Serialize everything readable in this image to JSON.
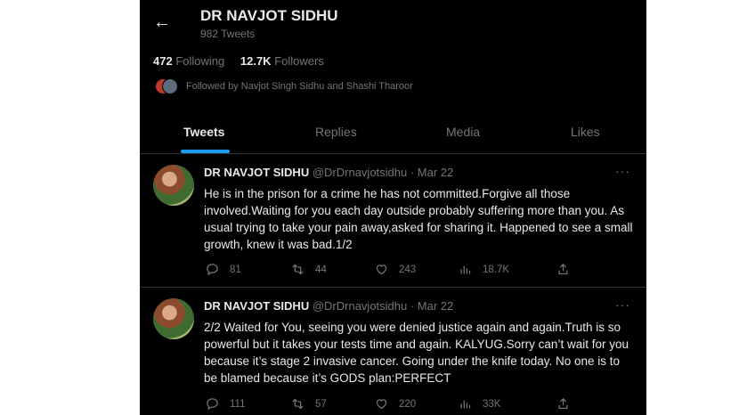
{
  "profile": {
    "name": "DR NAVJOT SIDHU",
    "tweet_count": "982 Tweets",
    "following_count": "472",
    "following_label": "Following",
    "followers_count": "12.7K",
    "followers_label": "Followers",
    "followed_by": "Followed by Navjot Singh Sidhu and Shashi Tharoor"
  },
  "tabs": [
    {
      "label": "Tweets",
      "active": true
    },
    {
      "label": "Replies"
    },
    {
      "label": "Media"
    },
    {
      "label": "Likes"
    }
  ],
  "tweets": [
    {
      "name": "DR NAVJOT SIDHU",
      "meta": "@DrDrnavjotsidhu · Mar 22",
      "text": "He is in the prison for a crime he has not committed.Forgive all those involved.Waiting for you each day outside probably suffering more than you. As usual trying to take your pain away,asked for sharing it. Happened to see a small growth, knew it was bad.1/2",
      "replies": "81",
      "retweets": "44",
      "likes": "243",
      "views": "18.7K"
    },
    {
      "name": "DR NAVJOT SIDHU",
      "meta": "@DrDrnavjotsidhu · Mar 22",
      "text": "2/2 Waited for You, seeing you were denied justice again and again.Truth is so powerful but it takes your tests time and again. KALYUG.Sorry can’t wait for you because it’s stage 2 invasive cancer. Going under the knife today. No one is to be blamed because it’s GODS plan:PERFECT",
      "replies": "111",
      "retweets": "57",
      "likes": "220",
      "views": "33K"
    }
  ],
  "icons": {
    "back": "arrow-left-icon",
    "reply": "comment-icon",
    "retweet": "retweet-icon",
    "like": "heart-icon",
    "views": "bar-chart-icon",
    "share": "share-icon",
    "more": "ellipsis-icon"
  },
  "colors": {
    "background": "#000000",
    "text": "#e7e9ea",
    "muted": "#71767b",
    "accent": "#1d9bf0"
  }
}
